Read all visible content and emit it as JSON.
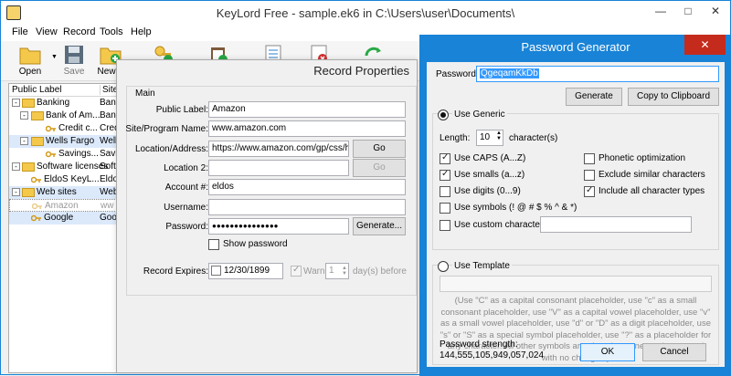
{
  "window": {
    "title": "KeyLord Free - sample.ek6 in C:\\Users\\user\\Documents\\"
  },
  "menu": [
    "File",
    "View",
    "Record",
    "Tools",
    "Help"
  ],
  "toolbar": {
    "open": "Open",
    "save": "Save",
    "new": "New F"
  },
  "tree": {
    "headers": {
      "label": "Public Label",
      "site": "Site/"
    },
    "rows": [
      {
        "name": "Banking",
        "site": "Banki"
      },
      {
        "name": "Bank of Am...",
        "site": "Bank"
      },
      {
        "name": "Credit c...",
        "site": "Credi"
      },
      {
        "name": "Wells Fargo",
        "site": "Wells"
      },
      {
        "name": "Savings...",
        "site": "Savin"
      },
      {
        "name": "Software licenses",
        "site": "Softv"
      },
      {
        "name": "EldoS KeyL...",
        "site": "EldoS"
      },
      {
        "name": "Web sites",
        "site": "Web"
      },
      {
        "name": "Amazon",
        "site": "ww"
      },
      {
        "name": "Google",
        "site": "Goog"
      }
    ]
  },
  "record": {
    "title": "Record Properties",
    "group": "Main",
    "labels": {
      "public_label": "Public Label:",
      "site": "Site/Program Name:",
      "location": "Location/Address:",
      "location2": "Location 2:",
      "account": "Account #:",
      "username": "Username:",
      "password": "Password:",
      "show_password": "Show password",
      "expires": "Record Expires:",
      "warn": "Warn",
      "days": "day(s) before"
    },
    "values": {
      "public_label": "Amazon",
      "site": "www.amazon.com",
      "location": "https://www.amazon.com/gp/css/homep",
      "location2": "",
      "account": "eldos",
      "username": "",
      "password": "●●●●●●●●●●●●●●●",
      "expires": "12/30/1899",
      "warn_days": "1"
    },
    "buttons": {
      "go1": "Go",
      "go2": "Go",
      "generate": "Generate..."
    }
  },
  "generator": {
    "title": "Password Generator",
    "password_label": "Password:",
    "password_value": "QgeqamKkDb",
    "generate_btn": "Generate",
    "copy_btn": "Copy to Clipboard",
    "use_generic": "Use Generic",
    "length_label": "Length:",
    "length_value": "10",
    "length_unit": "character(s)",
    "options": {
      "caps": "Use CAPS (A...Z)",
      "smalls": "Use smalls (a...z)",
      "digits": "Use digits (0...9)",
      "symbols": "Use symbols (! @ # $ % ^ & *)",
      "custom": "Use custom characters:",
      "phonetic": "Phonetic optimization",
      "exclude": "Exclude similar characters",
      "include_all": "Include all character types"
    },
    "use_template": "Use Template",
    "template_note": "(Use \"C\" as a capital consonant placeholder, use \"c\" as a small consonant placeholder, use \"V\" as a capital vowel placeholder, use \"v\" as a small vowel placeholder, use \"d\" or \"D\" as a digit placeholder, use \"s\" or \"S\" as a special symbol placeholder, use \"?\" as a placeholder for any character. All other symbols are placed to generated password with no changes.)",
    "strength_label": "Password strength:",
    "strength_value": "144,555,105,949,057,024",
    "ok": "OK",
    "cancel": "Cancel"
  }
}
